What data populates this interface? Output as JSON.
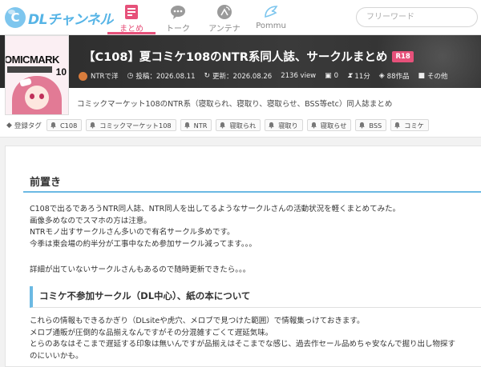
{
  "site": {
    "logo_text": "DLチャンネル",
    "logo_mark": "C"
  },
  "nav": [
    {
      "label": "まとめ",
      "icon": "matome-book-icon",
      "active": true
    },
    {
      "label": "トーク",
      "icon": "chat-bubble-icon",
      "active": false
    },
    {
      "label": "アンテナ",
      "icon": "antenna-icon",
      "active": false
    },
    {
      "label": "Pommu",
      "icon": "wing-icon",
      "active": false
    }
  ],
  "search": {
    "placeholder": "フリーワード",
    "value": ""
  },
  "cover": {
    "title": "OMICMARK",
    "num": "10"
  },
  "article": {
    "title": "【C108】夏コミケ108のNTR系同人誌、サークルまとめ",
    "rating_badge": "R18",
    "author": "NTRで洋",
    "posted": "投稿：2026.08.11",
    "updated": "更新：2026.08.26",
    "views": "2136 view",
    "comments": "0",
    "read_time": "11分",
    "works": "88作品",
    "other": "その他",
    "description": "コミックマーケット108のNTR系（寝取られ、寝取り、寝取らせ、BSS等etc）同人誌まとめ",
    "tags_label": "登録タグ",
    "tags": [
      "C108",
      "コミックマーケット108",
      "NTR",
      "寝取られ",
      "寝取り",
      "寝取らせ",
      "BSS",
      "コミケ"
    ]
  },
  "body": {
    "h_preface": "前置き",
    "p1": [
      "C108で出るであろうNTR同人誌、NTR同人を出してるようなサークルさんの活動状況を軽くまとめてみた。",
      "画像多めなのでスマホの方は注意。",
      "NTRモノ出すサークルさん多いので有名サークル多めです。",
      "今季は東会場の約半分が工事中なため参加サークル減ってます。。。"
    ],
    "p2": [
      "詳細が出ていないサークルさんもあるので随時更新できたら。。。"
    ],
    "h_section": "コミケ不参加サークル（DL中心）、紙の本について",
    "p3": [
      "これらの情報もできるかぎり（DLsiteや虎穴、メロブで見つけた範囲）で情報集っけておきます。",
      "メロブ通販が圧倒的な品揃えなんですがその分混雑すごくて遅延気味。",
      "とらのあなはそこまで遅延する印象は無いんですが品揃えはそこまでな感じ、過去作セール品めちゃ安なんで掘り出し物探す",
      "のにいいかも。"
    ]
  },
  "colors": {
    "accent_pink": "#e6517a",
    "accent_blue": "#6bb9e3",
    "hero_bg": "#333333"
  }
}
